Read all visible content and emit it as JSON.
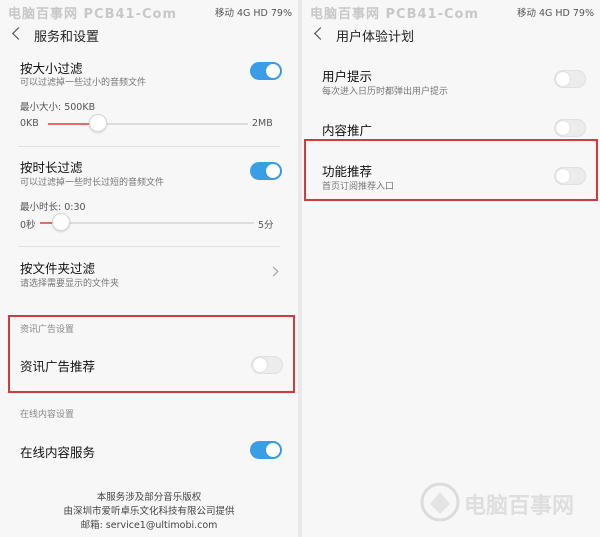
{
  "watermark": "电脑百事网 PCB41-Com",
  "status": {
    "carrier": "移动 4G HD",
    "battery": "79%"
  },
  "left": {
    "title": "服务和设置",
    "size_filter": {
      "label": "按大小过滤",
      "desc": "可以过滤掉一些过小的音频文件",
      "min_label": "最小大小: 500KB",
      "range_min": "0KB",
      "range_max": "2MB",
      "slider_fraction": 0.25,
      "enabled": true
    },
    "duration_filter": {
      "label": "按时长过滤",
      "desc": "可以过滤掉一些时长过短的音频文件",
      "min_label": "最小时长: 0:30",
      "range_min": "0秒",
      "range_max": "5分",
      "slider_fraction": 0.1,
      "enabled": true
    },
    "folder_filter": {
      "label": "按文件夹过滤",
      "desc": "请选择需要显示的文件夹"
    },
    "ad_section": {
      "header": "资讯广告设置",
      "label": "资讯广告推荐",
      "enabled": false
    },
    "online_section": {
      "header": "在线内容设置",
      "label": "在线内容服务",
      "enabled": true
    },
    "footer": {
      "line1": "本服务涉及部分音乐版权",
      "line2": "由深圳市爱听卓乐文化科技有限公司提供",
      "line3": "邮箱: service1@ultimobi.com"
    }
  },
  "right": {
    "title": "用户体验计划",
    "items": [
      {
        "label": "用户提示",
        "desc": "每次进入日历时都弹出用户提示",
        "enabled": false
      },
      {
        "label": "内容推广",
        "desc": "",
        "enabled": false
      },
      {
        "label": "功能推荐",
        "desc": "首页订阅推荐入口",
        "enabled": false
      }
    ]
  },
  "brand_watermark": "电脑百事网"
}
